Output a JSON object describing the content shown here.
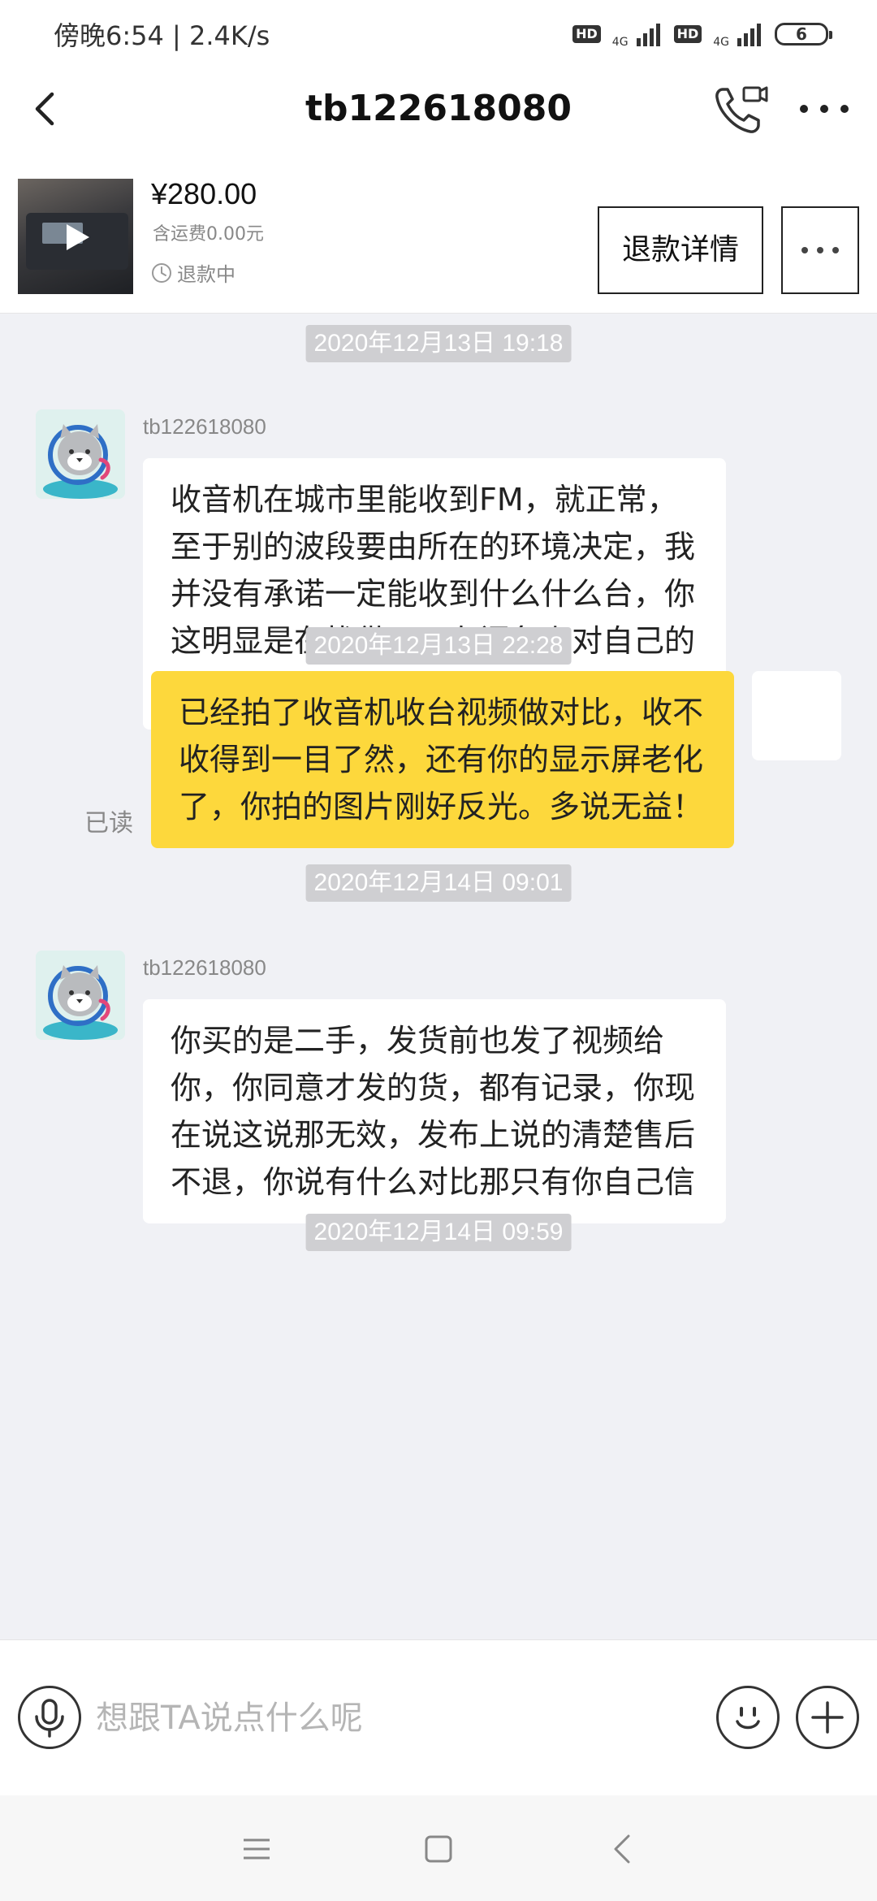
{
  "status_bar": {
    "time_speed": "傍晚6:54 | 2.4K/s",
    "hd1": "HD",
    "net1": "4G",
    "hd2": "HD",
    "net2": "4G",
    "battery": "6"
  },
  "nav": {
    "title": "tb122618080",
    "back_icon": "chevron-left-icon",
    "call_icon": "phone-video-icon",
    "more_icon": "more-dots-icon"
  },
  "product": {
    "price": "¥280.00",
    "shipping": "含运费0.00元",
    "status": "退款中",
    "refund_button": "退款详情"
  },
  "messages": [
    {
      "type": "time",
      "text": "2020年12月13日 19:18"
    },
    {
      "type": "incoming",
      "sender": "tb122618080",
      "text": "收音机在城市里能收到FM，就正常，至于别的波段要由所在的环境决定，我并没有承诺一定能收到什么什么台，你这明显是在找借口，在闲鱼上对自己的行为不负责任"
    },
    {
      "type": "time",
      "text": "2020年12月13日 22:28"
    },
    {
      "type": "outgoing",
      "text": "已经拍了收音机收台视频做对比，收不收得到一目了然，还有你的显示屏老化了，你拍的图片刚好反光。多说无益！",
      "read": "已读"
    },
    {
      "type": "time",
      "text": "2020年12月14日 09:01"
    },
    {
      "type": "incoming",
      "sender": "tb122618080",
      "text": "你买的是二手，发货前也发了视频给你，你同意才发的货，都有记录，你现在说这说那无效，发布上说的清楚售后不退，你说有什么对比那只有你自己信"
    },
    {
      "type": "time",
      "text": "2020年12月14日 09:59"
    }
  ],
  "input": {
    "placeholder": "想跟TA说点什么呢",
    "value": ""
  },
  "colors": {
    "outgoing_bubble": "#fdd83c",
    "chat_bg": "#f0f1f5",
    "timestamp_bg": "#cfcfd2"
  }
}
